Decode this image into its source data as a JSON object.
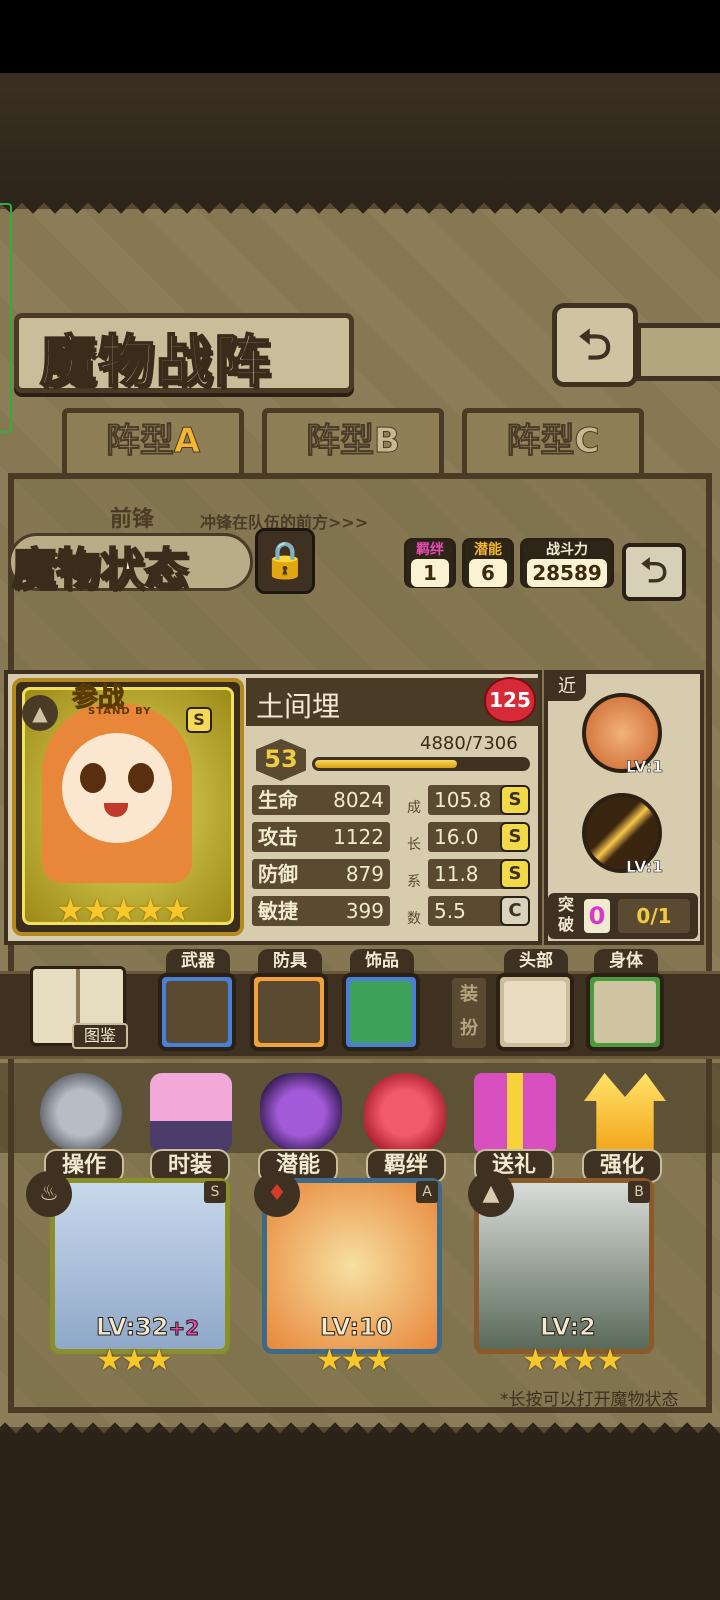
{
  "header": {
    "title": "魔物战阵",
    "back_icon": "back-arrow-icon"
  },
  "tabs": [
    {
      "prefix": "阵型",
      "suffix": "A",
      "active": true
    },
    {
      "prefix": "阵型",
      "suffix": "B",
      "active": false
    },
    {
      "prefix": "阵型",
      "suffix": "C",
      "active": false
    }
  ],
  "formation": {
    "row_label": "前锋",
    "row_desc": "冲锋在队伍的前方>>>",
    "hint": "*长按可以打开魔物状态"
  },
  "status": {
    "title": "魔物状态",
    "lock_icon": "lock-icon",
    "bond_label": "羁绊",
    "bond_value": "1",
    "potential_label": "潜能",
    "potential_value": "6",
    "power_label": "战斗力",
    "power_value": "28589"
  },
  "monster": {
    "name": "土间埋",
    "affection": "125",
    "badge_top": "参战",
    "badge_sub": "STAND BY",
    "rank": "S",
    "stars": "★★★★★",
    "level": "53",
    "exp_text": "4880/7306",
    "exp_ratio": 0.668,
    "growth_label_chars": [
      "成",
      "长",
      "系",
      "数"
    ],
    "stats": [
      {
        "name": "生命",
        "value": "8024",
        "growth": "105.8",
        "grade": "S"
      },
      {
        "name": "攻击",
        "value": "1122",
        "growth": "16.0",
        "grade": "S"
      },
      {
        "name": "防御",
        "value": "879",
        "growth": "11.8",
        "grade": "S"
      },
      {
        "name": "敏捷",
        "value": "399",
        "growth": "5.5",
        "grade": "C"
      }
    ]
  },
  "skills": {
    "range_tag": "近",
    "items": [
      {
        "icon": "bread-skill-icon",
        "lv": "LV:1"
      },
      {
        "icon": "slash-skill-icon",
        "lv": "LV:1"
      }
    ],
    "break_label": "突破",
    "break_count": "0",
    "break_progress": "0/1"
  },
  "equipment": {
    "book_label": "图鉴",
    "dress_label": "装扮",
    "slots": [
      {
        "label": "武器",
        "icon": "gatling-gun-icon",
        "color": "#4a7fd6"
      },
      {
        "label": "防具",
        "icon": "compass-armor-icon",
        "color": "#f2a23a"
      },
      {
        "label": "饰品",
        "icon": "potion-bottle-icon",
        "color": "#4a7fd6"
      },
      {
        "label": "头部",
        "icon": "headband-icon",
        "color": "#c9bd9a"
      },
      {
        "label": "身体",
        "icon": "stars-body-icon",
        "color": "#4c9a3c"
      }
    ]
  },
  "actions": [
    {
      "label": "操作",
      "icon": "gear-icon"
    },
    {
      "label": "时装",
      "icon": "outfit-icon"
    },
    {
      "label": "潜能",
      "icon": "demon-potential-icon"
    },
    {
      "label": "羁绊",
      "icon": "hearts-bond-icon"
    },
    {
      "label": "送礼",
      "icon": "gift-icon"
    },
    {
      "label": "强化",
      "icon": "upgrade-arrows-icon"
    }
  ],
  "team": [
    {
      "lv": "LV:32",
      "plus": "+2",
      "grade": "S",
      "element": "water-icon",
      "stars": "★★★"
    },
    {
      "lv": "LV:10",
      "plus": "",
      "grade": "A",
      "element": "fire-icon",
      "stars": "★★★"
    },
    {
      "lv": "LV:2",
      "plus": "",
      "grade": "B",
      "element": "earth-icon",
      "stars": "★★★★"
    }
  ]
}
